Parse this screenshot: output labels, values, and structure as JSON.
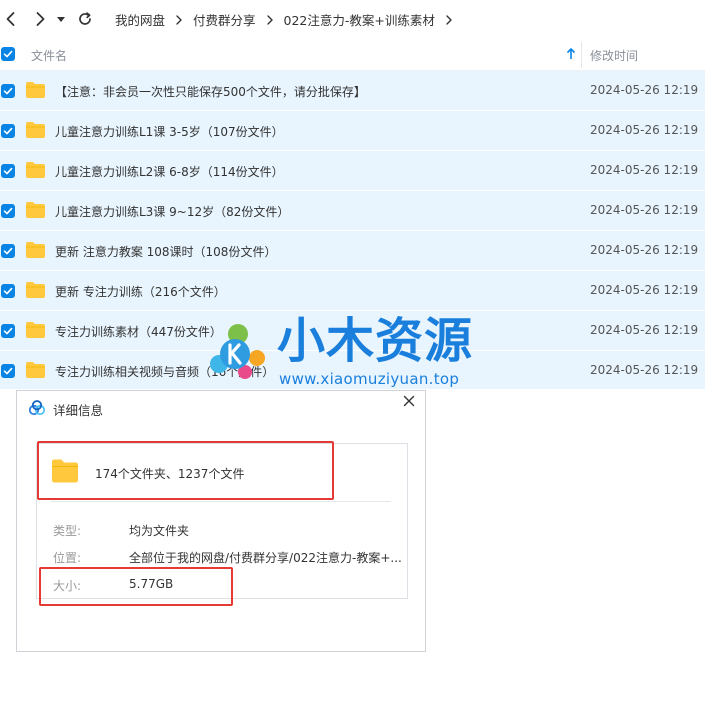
{
  "breadcrumb": [
    "我的网盘",
    "付费群分享",
    "022注意力-教案+训练素材"
  ],
  "header": {
    "name_col": "文件名",
    "time_col": "修改时间"
  },
  "rows": [
    {
      "name": "【注意：非会员一次性只能保存500个文件，请分批保存】",
      "time": "2024-05-26 12:19"
    },
    {
      "name": "儿童注意力训练L1课 3-5岁（107份文件）",
      "time": "2024-05-26 12:19"
    },
    {
      "name": "儿童注意力训练L2课 6-8岁（114份文件）",
      "time": "2024-05-26 12:19"
    },
    {
      "name": "儿童注意力训练L3课 9~12岁（82份文件）",
      "time": "2024-05-26 12:19"
    },
    {
      "name": "更新 注意力教案 108课时（108份文件）",
      "time": "2024-05-26 12:19"
    },
    {
      "name": "更新 专注力训练（216个文件）",
      "time": "2024-05-26 12:19"
    },
    {
      "name": "专注力训练素材（447份文件）",
      "time": "2024-05-26 12:19"
    },
    {
      "name": "专注力训练相关视频与音频（16个文件）",
      "time": "2024-05-26 12:19"
    }
  ],
  "watermark": {
    "title": "小木资源",
    "url": "www.xiaomuziyuan.top"
  },
  "dialog": {
    "title": "详细信息",
    "summary": "174个文件夹、1237个文件",
    "type_label": "类型:",
    "type_value": "均为文件夹",
    "location_label": "位置:",
    "location_value": "全部位于我的网盘/付费群分享/022注意力-教案+...",
    "size_label": "大小:",
    "size_value": "5.77GB"
  },
  "colors": {
    "accent": "#0a84e4",
    "row_selected": "#e8f5fe",
    "folder": "#ffc83d",
    "highlight": "#e53935",
    "watermark": "#1a7fdc"
  }
}
